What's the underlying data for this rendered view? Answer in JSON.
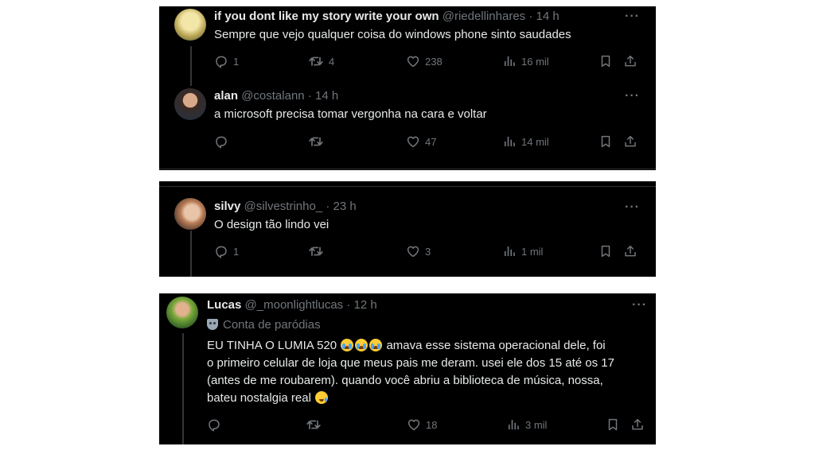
{
  "panels": [
    {
      "tweets": [
        {
          "name": "if you dont like my story write your own",
          "handle": "@riedellinhares",
          "sep": "·",
          "time": "14 h",
          "text": "Sempre que vejo qualquer coisa do windows phone sinto saudades",
          "replies": "1",
          "retweets": "4",
          "likes": "238",
          "views": "16 mil"
        },
        {
          "name": "alan",
          "handle": "@costalann",
          "sep": "·",
          "time": "14 h",
          "text": "a microsoft precisa tomar vergonha na cara e voltar",
          "replies": "",
          "retweets": "",
          "likes": "47",
          "views": "14 mil"
        }
      ]
    },
    {
      "tweets": [
        {
          "name": "silvy",
          "handle": "@silvestrinho_",
          "sep": "·",
          "time": "23 h",
          "text": "O design tão lindo vei",
          "replies": "1",
          "retweets": "",
          "likes": "3",
          "views": "1 mil"
        }
      ]
    },
    {
      "tweets": [
        {
          "name": "Lucas",
          "handle": "@_moonlightlucas",
          "sep": "·",
          "time": "12 h",
          "parody_label": "Conta de paródias",
          "text_line1_a": "EU TINHA O LUMIA 520",
          "text_line1_b": "amava esse sistema operacional dele, foi",
          "text_line2": "o primeiro celular de loja que meus pais me deram. usei ele dos 15 até os 17",
          "text_line3": "(antes de me roubarem). quando você abriu a biblioteca de música, nossa,",
          "text_line4": "bateu nostalgia real",
          "replies": "",
          "retweets": "",
          "likes": "18",
          "views": "3 mil"
        }
      ]
    }
  ],
  "icons": {
    "more": "more-dots-icon",
    "reply": "reply-icon",
    "retweet": "retweet-icon",
    "like": "heart-icon",
    "views": "views-icon",
    "bookmark": "bookmark-icon",
    "share": "share-icon",
    "emoji_cry": "loudly-crying-emoji",
    "emoji_smile_tear": "smiling-face-with-tear-emoji",
    "parody": "performing-arts-icon"
  },
  "colors": {
    "background": "#000000",
    "text": "#e7e9ea",
    "secondary": "#71767b",
    "page": "#ffffff"
  }
}
